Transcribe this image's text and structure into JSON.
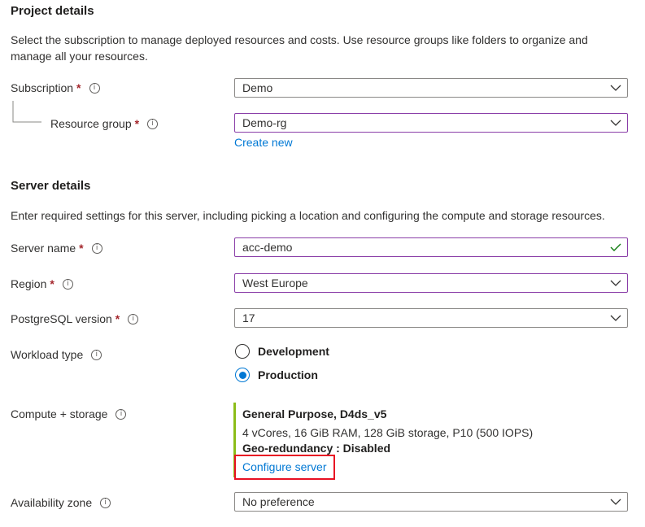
{
  "project": {
    "title": "Project details",
    "description": "Select the subscription to manage deployed resources and costs. Use resource groups like folders to organize and manage all your resources.",
    "subscription": {
      "label": "Subscription",
      "required": "*",
      "value": "Demo"
    },
    "resource_group": {
      "label": "Resource group",
      "required": "*",
      "value": "Demo-rg",
      "create_new": "Create new"
    }
  },
  "server": {
    "title": "Server details",
    "description": "Enter required settings for this server, including picking a location and configuring the compute and storage resources.",
    "server_name": {
      "label": "Server name",
      "required": "*",
      "value": "acc-demo"
    },
    "region": {
      "label": "Region",
      "required": "*",
      "value": "West Europe"
    },
    "version": {
      "label": "PostgreSQL version",
      "required": "*",
      "value": "17"
    },
    "workload": {
      "label": "Workload type",
      "options": [
        "Development",
        "Production"
      ],
      "selected": "Production"
    },
    "compute": {
      "label": "Compute + storage",
      "tier": "General Purpose, D4ds_v5",
      "specs": "4 vCores, 16 GiB RAM, 128 GiB storage, P10 (500 IOPS)",
      "geo": "Geo-redundancy : Disabled",
      "configure": "Configure server"
    },
    "availability": {
      "label": "Availability zone",
      "value": "No preference"
    }
  },
  "colors": {
    "accent": "#0078d4",
    "focus": "#8a3ea8",
    "success": "#107c10",
    "highlight": "#e81123",
    "compute_bar": "#8cbd18"
  }
}
